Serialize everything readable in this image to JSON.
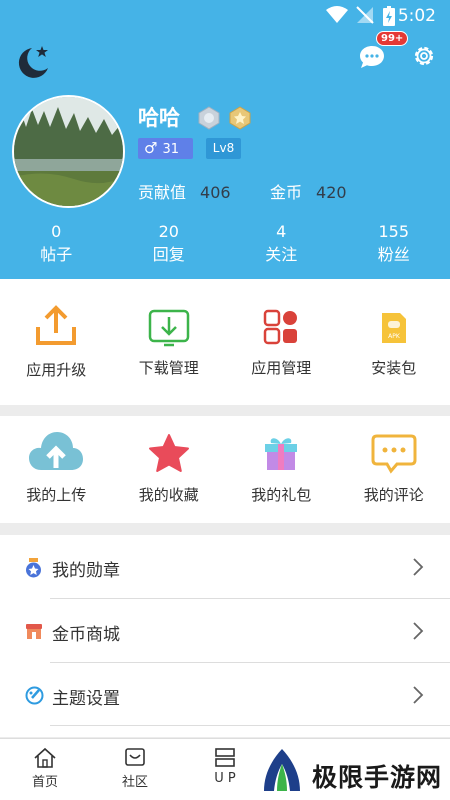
{
  "status_bar": {
    "time": "5:02"
  },
  "header": {
    "notification_badge": "99+",
    "user": {
      "name": "哈哈",
      "gender_age": "31",
      "level": "Lv8",
      "contribution_label": "贡献值",
      "contribution_value": "406",
      "coins_label": "金币",
      "coins_value": "420"
    },
    "counts": [
      {
        "value": "0",
        "label": "帖子"
      },
      {
        "value": "20",
        "label": "回复"
      },
      {
        "value": "4",
        "label": "关注"
      },
      {
        "value": "155",
        "label": "粉丝"
      }
    ]
  },
  "tools": [
    {
      "label": "应用升级",
      "icon": "upload-icon"
    },
    {
      "label": "下载管理",
      "icon": "download-icon"
    },
    {
      "label": "应用管理",
      "icon": "apps-icon"
    },
    {
      "label": "安装包",
      "icon": "apk-icon"
    }
  ],
  "mine": [
    {
      "label": "我的上传",
      "icon": "cloud-upload-icon"
    },
    {
      "label": "我的收藏",
      "icon": "star-icon"
    },
    {
      "label": "我的礼包",
      "icon": "gift-icon"
    },
    {
      "label": "我的评论",
      "icon": "comment-icon"
    }
  ],
  "menu": [
    {
      "label": "我的勋章",
      "icon": "medal-icon"
    },
    {
      "label": "金币商城",
      "icon": "shop-icon"
    },
    {
      "label": "主题设置",
      "icon": "palette-icon"
    }
  ],
  "tabbar": {
    "items": [
      {
        "label": "首页",
        "icon": "home-icon"
      },
      {
        "label": "社区",
        "icon": "community-icon"
      },
      {
        "label": "U P",
        "icon": "up-icon"
      }
    ]
  },
  "watermark": {
    "text": "极限手游网"
  },
  "colors": {
    "header_bg": "#45b3e7",
    "accent_orange": "#f39b2f",
    "accent_green": "#3cb44a",
    "accent_red": "#d9423a"
  }
}
